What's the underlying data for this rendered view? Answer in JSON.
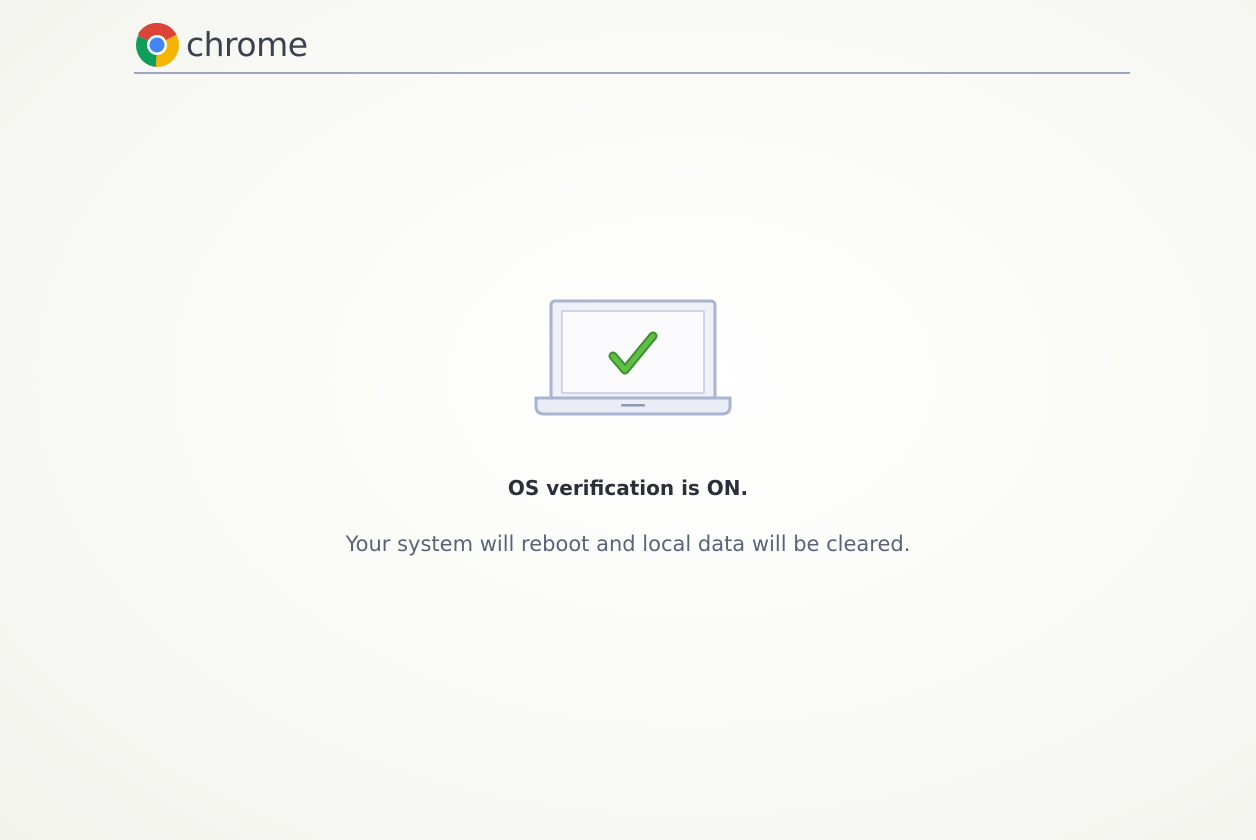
{
  "header": {
    "brand_text": "chrome",
    "logo_icon": "chrome-logo-icon",
    "rule_color": "#9ea7bd"
  },
  "status": {
    "illustration_icon": "laptop-checkmark-icon",
    "title": "OS verification is ON.",
    "message": "Your system will reboot and local data will be cleared."
  },
  "colors": {
    "check_green": "#4aa238",
    "laptop_outline": "#aab4d0",
    "text_dark": "#2b2f3a",
    "text_muted": "#5a6378"
  }
}
